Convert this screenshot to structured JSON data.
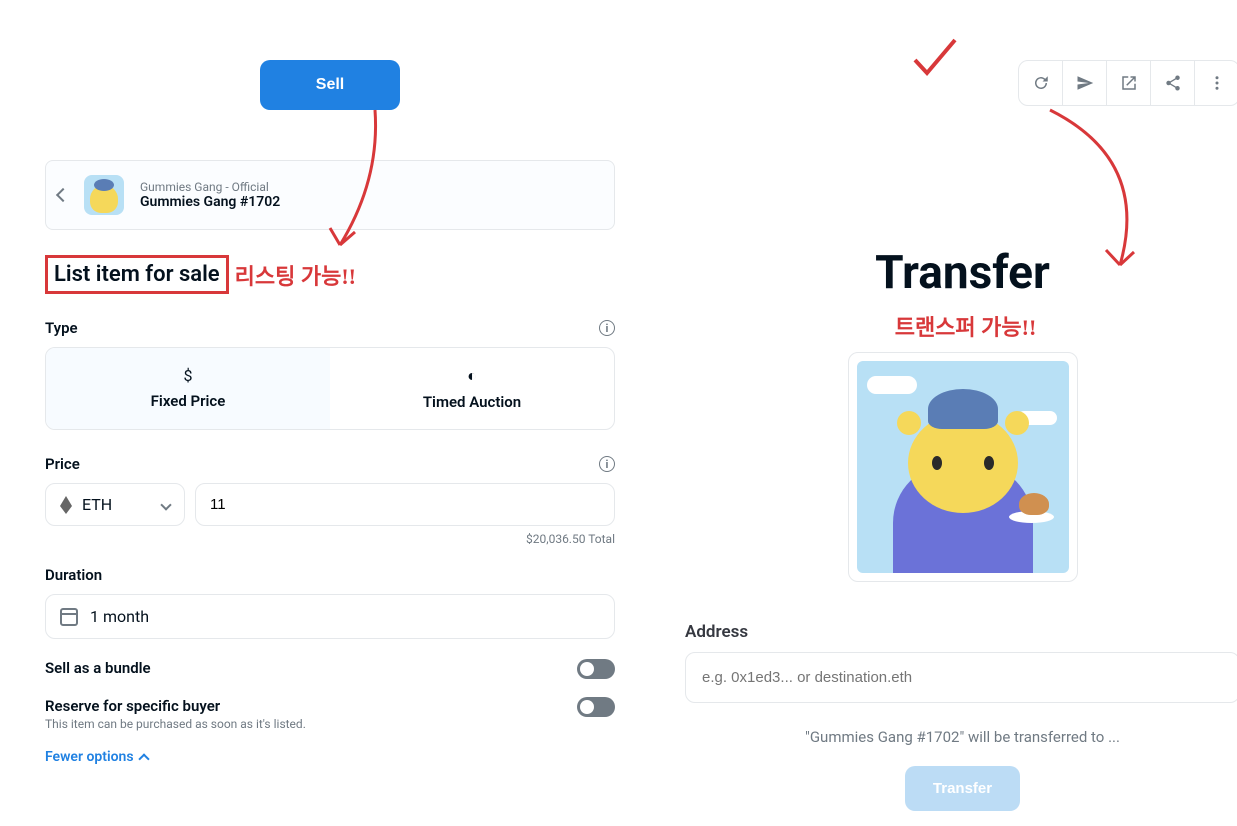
{
  "colors": {
    "accent": "#2081e2",
    "annotation": "#d8383a"
  },
  "sell": {
    "button_label": "Sell"
  },
  "breadcrumb": {
    "collection": "Gummies Gang - Official",
    "name": "Gummies Gang #1702"
  },
  "listing": {
    "title": "List item for sale",
    "annotation": "리스팅 가능!!",
    "type_label": "Type",
    "type_options": {
      "fixed": "Fixed Price",
      "auction": "Timed Auction"
    },
    "price_label": "Price",
    "currency": "ETH",
    "price_value": "11",
    "price_total": "$20,036.50 Total",
    "duration_label": "Duration",
    "duration_value": "1 month",
    "bundle_label": "Sell as a bundle",
    "reserve_label": "Reserve for specific buyer",
    "reserve_help": "This item can be purchased as soon as it's listed.",
    "fewer_options": "Fewer options"
  },
  "transfer": {
    "title": "Transfer",
    "annotation": "트랜스퍼 가능!!",
    "address_label": "Address",
    "address_placeholder": "e.g. 0x1ed3... or destination.eth",
    "note": "\"Gummies Gang #1702\" will be transferred to ...",
    "button_label": "Transfer"
  },
  "icons": {
    "refresh": "refresh-icon",
    "send": "send-icon",
    "external": "external-link-icon",
    "share": "share-icon",
    "more": "more-icon"
  }
}
